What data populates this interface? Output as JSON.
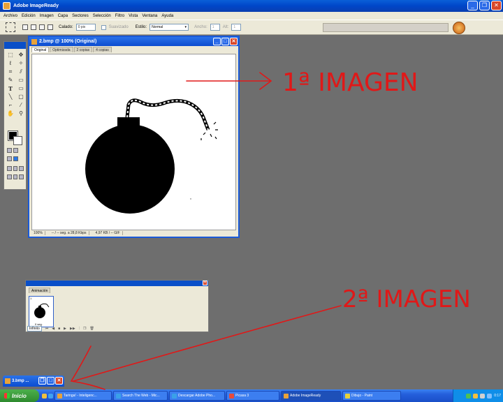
{
  "window": {
    "title": "Adobe ImageReady"
  },
  "menu": [
    "Archivo",
    "Edición",
    "Imagen",
    "Capa",
    "Sectores",
    "Selección",
    "Filtro",
    "Vista",
    "Ventana",
    "Ayuda"
  ],
  "options": {
    "calado_label": "Calado:",
    "calado_value": "0 pix",
    "suavizado_label": "Suavizado",
    "estilo_label": "Estilo:",
    "estilo_value": "Normal",
    "ancho_label": "Ancho:",
    "ancho_value": "1",
    "alto_label": "Alt:",
    "alto_value": "1"
  },
  "document": {
    "title": "2.bmp @ 100% (Original)",
    "tabs": [
      "Original",
      "Optimizada",
      "2 copias",
      "4 copias"
    ],
    "status": [
      "100%",
      "-- / -- seg. a 28,8 Kbps",
      "4,97 KB / -- GIF"
    ]
  },
  "animation": {
    "tab": "Animación",
    "frame_number": "1",
    "frame_delay": "0 seg.",
    "loop": "Infinito"
  },
  "minimized": {
    "title": "3.bmp ..."
  },
  "taskbar": {
    "start": "Inicio",
    "items": [
      {
        "label": "Taringa! - Inteligenc...",
        "color": "#e8a23a"
      },
      {
        "label": "Search The Web - Mic...",
        "color": "#3aa0e8"
      },
      {
        "label": "Descargar Adobe Pho...",
        "color": "#3aa0e8"
      },
      {
        "label": "Picasa 3",
        "color": "#e84a3a"
      },
      {
        "label": "Adobe ImageReady",
        "color": "#e8a23a"
      },
      {
        "label": "Dibujo - Paint",
        "color": "#e8d03a"
      }
    ],
    "lang": "ES",
    "clock": "0:17"
  },
  "annotations": {
    "first": "1ª IMAGEN",
    "second": "2ª IMAGEN"
  },
  "colors": {
    "annotation": "#e01818",
    "xp_blue": "#0a4fc8",
    "workspace": "#6e6e6e"
  }
}
